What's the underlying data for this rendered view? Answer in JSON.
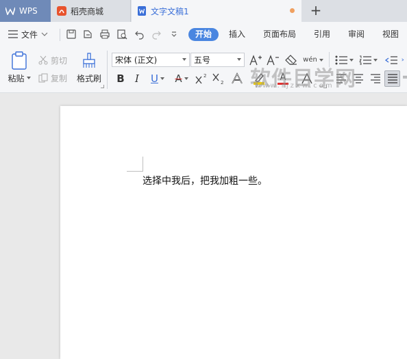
{
  "tabs": {
    "wps_label": "WPS",
    "shell_label": "稻壳商城",
    "doc_label": "文字文稿1"
  },
  "menu": {
    "file_label": "文件",
    "tabs": [
      "开始",
      "插入",
      "页面布局",
      "引用",
      "审阅",
      "视图"
    ],
    "active_tab": "开始"
  },
  "ribbon": {
    "paste_label": "粘贴",
    "cut_label": "剪切",
    "copy_label": "复制",
    "format_painter_label": "格式刷",
    "font_name": "宋体 (正文)",
    "font_size": "五号",
    "phonetic_label": "wén"
  },
  "watermark": {
    "main": "软件目学网",
    "sub": "www.rjzxw.com"
  },
  "document": {
    "text": "选择中我后，把我加粗一些。"
  },
  "colors": {
    "accent": "#4a86e0",
    "wps_tab": "#6f8ab8",
    "tab_dot": "#f0a060",
    "highlight_bar": "#f5d000",
    "font_color_bar": "#e03030"
  }
}
